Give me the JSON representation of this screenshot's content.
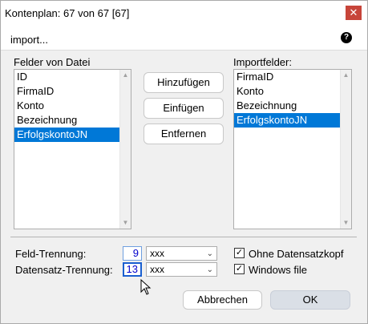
{
  "window": {
    "title": "Kontenplan: 67 von 67 [67]",
    "close_glyph": "✕"
  },
  "header": {
    "label": "import...",
    "help_glyph": "?"
  },
  "left_list": {
    "label": "Felder von Datei",
    "items": [
      "ID",
      "FirmaID",
      "Konto",
      "Bezeichnung",
      "ErfolgskontoJN"
    ],
    "selected_index": 4
  },
  "right_list": {
    "label": "Importfelder:",
    "items": [
      "FirmaID",
      "Konto",
      "Bezeichnung",
      "ErfolgskontoJN"
    ],
    "selected_index": 3
  },
  "buttons": {
    "add": "Hinzufügen",
    "insert": "Einfügen",
    "remove": "Entfernen",
    "cancel": "Abbrechen",
    "ok": "OK"
  },
  "field_sep": {
    "label": "Feld-Trennung:",
    "value": "9",
    "combo_value": "xxx"
  },
  "record_sep": {
    "label": "Datensatz-Trennung:",
    "value": "13",
    "combo_value": "xxx"
  },
  "options": {
    "no_header": {
      "label": "Ohne Datensatzkopf",
      "checked": true
    },
    "windows_file": {
      "label": "Windows file",
      "checked": true
    }
  },
  "icons": {
    "help": "help-icon",
    "close": "close-icon",
    "scroll_up": "scroll-up-arrow-icon",
    "scroll_down": "scroll-down-arrow-icon",
    "combo_arrow": "chevron-down-icon",
    "cursor": "mouse-cursor-icon"
  },
  "colors": {
    "selection": "#0078d7",
    "close_button": "#c7453a",
    "ok_button": "#dadfe6"
  }
}
